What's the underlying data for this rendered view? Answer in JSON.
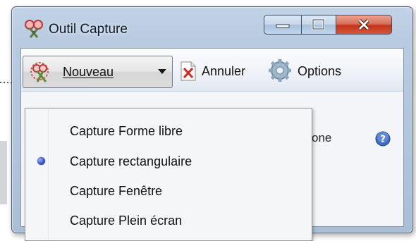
{
  "window": {
    "title": "Outil Capture",
    "icon": "scissors-app-icon",
    "caption_buttons": [
      "minimize-icon",
      "maximize-icon",
      "close-icon"
    ]
  },
  "toolbar": {
    "new_label": "Nouveau",
    "cancel_label": "Annuler",
    "options_label": "Options"
  },
  "partial_text": "one",
  "menu": {
    "items": [
      {
        "label": "Capture Forme libre",
        "selected": false
      },
      {
        "label": "Capture rectangulaire",
        "selected": true
      },
      {
        "label": "Capture Fenêtre",
        "selected": false
      },
      {
        "label": "Capture Plein écran",
        "selected": false
      }
    ]
  },
  "colors": {
    "title_glass": "#b9cbe0",
    "close_red": "#c2361b",
    "radio_blue": "#3a55c8"
  }
}
